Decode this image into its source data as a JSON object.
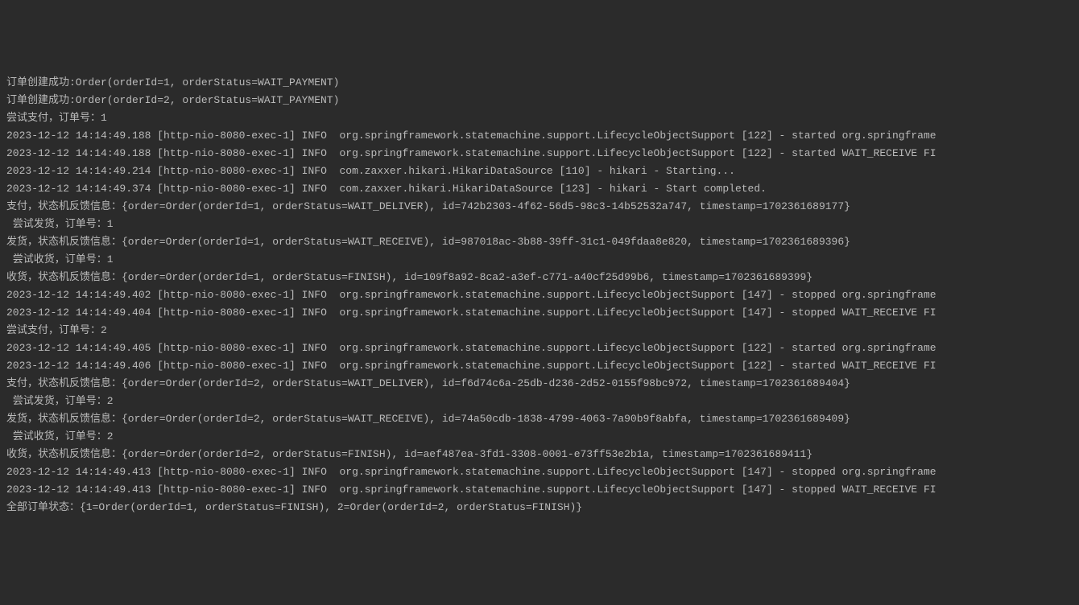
{
  "lines": [
    "订单创建成功:Order(orderId=1, orderStatus=WAIT_PAYMENT)",
    "订单创建成功:Order(orderId=2, orderStatus=WAIT_PAYMENT)",
    "尝试支付，订单号：1",
    "2023-12-12 14:14:49.188 [http-nio-8080-exec-1] INFO  org.springframework.statemachine.support.LifecycleObjectSupport [122] - started org.springframe",
    "2023-12-12 14:14:49.188 [http-nio-8080-exec-1] INFO  org.springframework.statemachine.support.LifecycleObjectSupport [122] - started WAIT_RECEIVE FI",
    "2023-12-12 14:14:49.214 [http-nio-8080-exec-1] INFO  com.zaxxer.hikari.HikariDataSource [110] - hikari - Starting...",
    "2023-12-12 14:14:49.374 [http-nio-8080-exec-1] INFO  com.zaxxer.hikari.HikariDataSource [123] - hikari - Start completed.",
    "支付，状态机反馈信息：{order=Order(orderId=1, orderStatus=WAIT_DELIVER), id=742b2303-4f62-56d5-98c3-14b52532a747, timestamp=1702361689177}",
    " 尝试发货，订单号：1",
    "发货，状态机反馈信息：{order=Order(orderId=1, orderStatus=WAIT_RECEIVE), id=987018ac-3b88-39ff-31c1-049fdaa8e820, timestamp=1702361689396}",
    " 尝试收货，订单号：1",
    "收货，状态机反馈信息：{order=Order(orderId=1, orderStatus=FINISH), id=109f8a92-8ca2-a3ef-c771-a40cf25d99b6, timestamp=1702361689399}",
    "2023-12-12 14:14:49.402 [http-nio-8080-exec-1] INFO  org.springframework.statemachine.support.LifecycleObjectSupport [147] - stopped org.springframe",
    "2023-12-12 14:14:49.404 [http-nio-8080-exec-1] INFO  org.springframework.statemachine.support.LifecycleObjectSupport [147] - stopped WAIT_RECEIVE FI",
    "尝试支付，订单号：2",
    "2023-12-12 14:14:49.405 [http-nio-8080-exec-1] INFO  org.springframework.statemachine.support.LifecycleObjectSupport [122] - started org.springframe",
    "2023-12-12 14:14:49.406 [http-nio-8080-exec-1] INFO  org.springframework.statemachine.support.LifecycleObjectSupport [122] - started WAIT_RECEIVE FI",
    "支付，状态机反馈信息：{order=Order(orderId=2, orderStatus=WAIT_DELIVER), id=f6d74c6a-25db-d236-2d52-0155f98bc972, timestamp=1702361689404}",
    " 尝试发货，订单号：2",
    "发货，状态机反馈信息：{order=Order(orderId=2, orderStatus=WAIT_RECEIVE), id=74a50cdb-1838-4799-4063-7a90b9f8abfa, timestamp=1702361689409}",
    " 尝试收货，订单号：2",
    "收货，状态机反馈信息：{order=Order(orderId=2, orderStatus=FINISH), id=aef487ea-3fd1-3308-0001-e73ff53e2b1a, timestamp=1702361689411}",
    "2023-12-12 14:14:49.413 [http-nio-8080-exec-1] INFO  org.springframework.statemachine.support.LifecycleObjectSupport [147] - stopped org.springframe",
    "2023-12-12 14:14:49.413 [http-nio-8080-exec-1] INFO  org.springframework.statemachine.support.LifecycleObjectSupport [147] - stopped WAIT_RECEIVE FI",
    "全部订单状态：{1=Order(orderId=1, orderStatus=FINISH), 2=Order(orderId=2, orderStatus=FINISH)}"
  ]
}
